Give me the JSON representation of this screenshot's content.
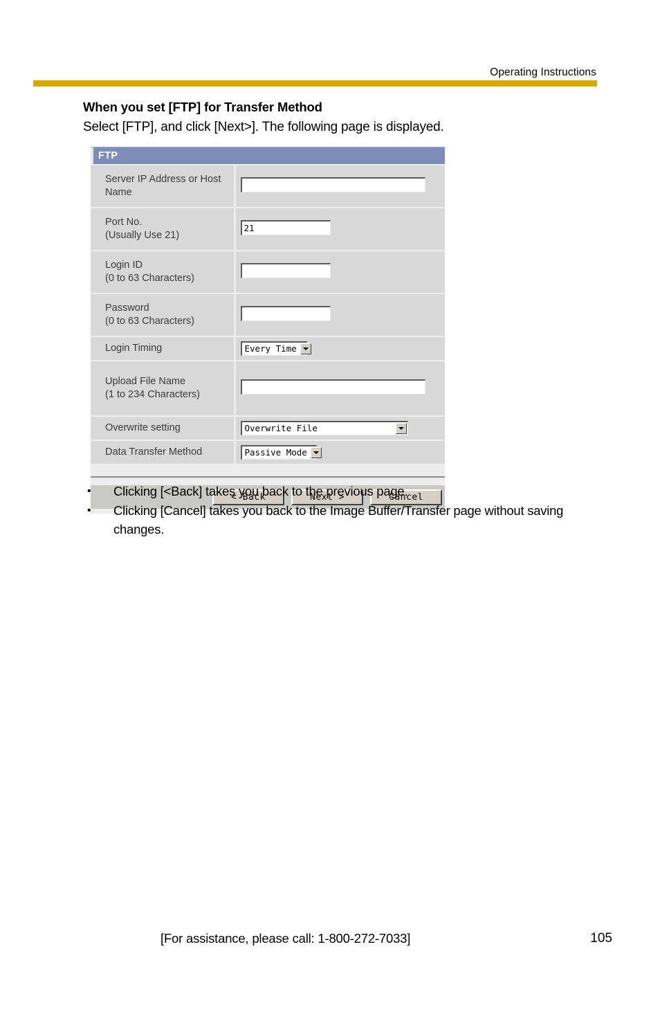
{
  "page": {
    "running_header": "Operating Instructions",
    "section_title": "When you set [FTP] for Transfer Method",
    "section_subtitle": "Select [FTP], and click [Next>]. The following page is displayed.",
    "accent_rule_color": "#d4aa06",
    "footer_assistance": "[For assistance, please call: 1-800-272-7033]",
    "page_number": "105"
  },
  "screenshot": {
    "title": "FTP",
    "title_bar_color": "#7d8db8",
    "rows": [
      {
        "label_line1": "Server IP Address or Host",
        "label_line2": "Name",
        "control": "text",
        "value": ""
      },
      {
        "label_line1": "Port No.",
        "label_line2": "(Usually Use 21)",
        "control": "text",
        "value": "21"
      },
      {
        "label_line1": "Login ID",
        "label_line2": "(0 to 63 Characters)",
        "control": "text",
        "value": ""
      },
      {
        "label_line1": "Password",
        "label_line2": "(0 to 63 Characters)",
        "control": "text",
        "value": ""
      },
      {
        "label_line1": "Login Timing",
        "label_line2": "",
        "control": "select",
        "value": "Every Time"
      },
      {
        "label_line1": "Upload File Name",
        "label_line2": "(1 to 234 Characters)",
        "control": "text",
        "value": ""
      },
      {
        "label_line1": "Overwrite setting",
        "label_line2": "",
        "control": "select",
        "value": "Overwrite File"
      },
      {
        "label_line1": "Data Transfer Method",
        "label_line2": "",
        "control": "select",
        "value": "Passive Mode"
      }
    ],
    "buttons": {
      "back": "< Back",
      "next": "Next >",
      "cancel": "Cancel"
    }
  },
  "notes": {
    "bullet_marker": "•",
    "items": [
      "Clicking [<Back] takes you back to the previous page.",
      "Clicking [Cancel] takes you back to the Image Buffer/Transfer page without saving changes."
    ]
  }
}
